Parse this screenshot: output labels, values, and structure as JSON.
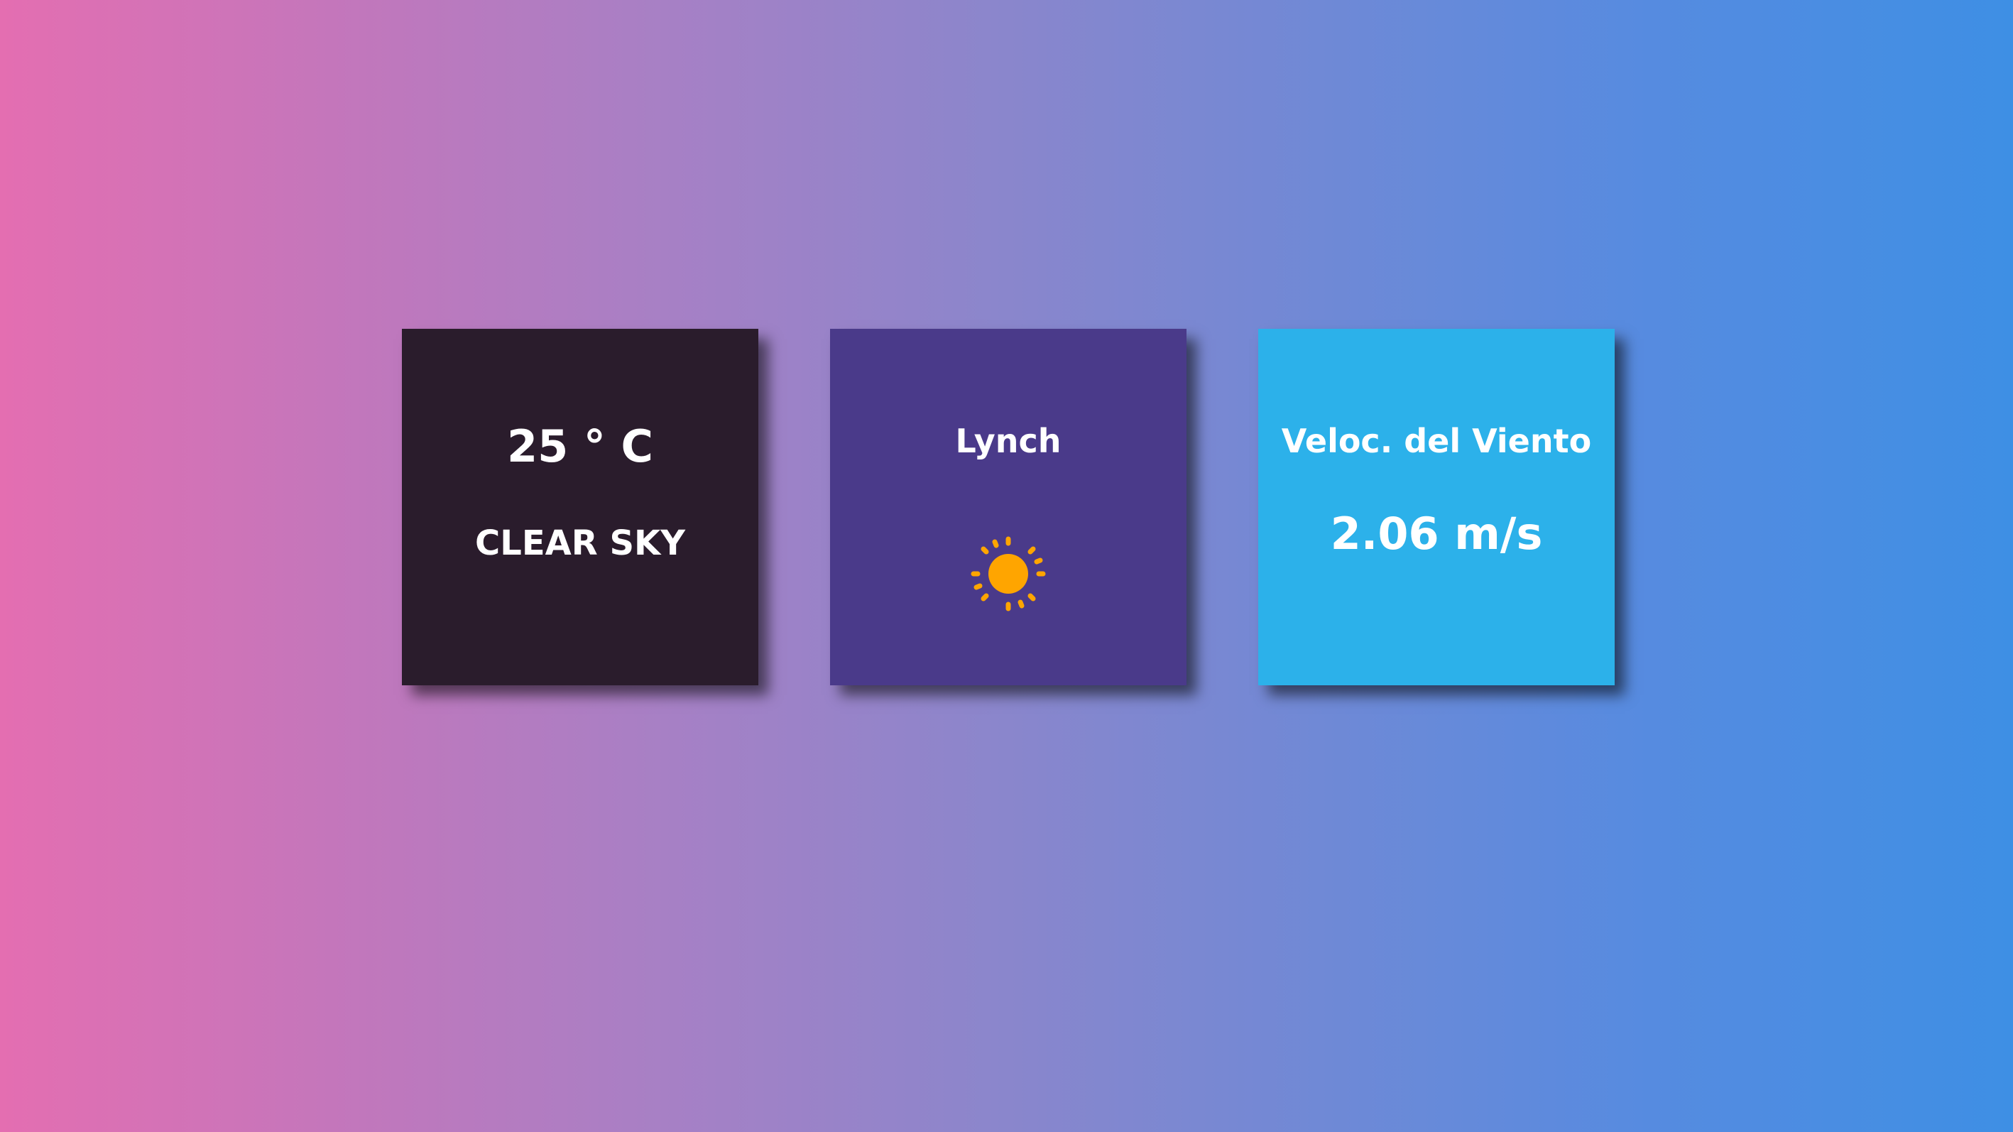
{
  "weather": {
    "temperature": "25 ° C",
    "description": "CLEAR SKY",
    "city": "Lynch",
    "icon": "sun-icon",
    "wind_label": "Veloc. del Viento",
    "wind_speed": "2.06 m/s"
  },
  "colors": {
    "temp_card": "#2a1c2c",
    "city_card": "#4a3a8a",
    "wind_card": "#2cb1ea",
    "sun": "#ffa500",
    "text": "#ffffff"
  }
}
